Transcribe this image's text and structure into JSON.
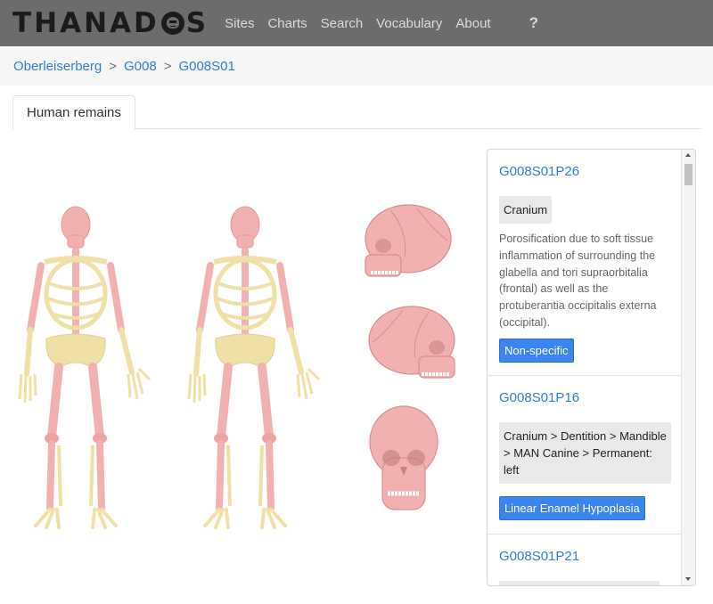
{
  "header": {
    "logo_text_pre": "THANAD",
    "logo_text_post": "S",
    "nav": [
      "Sites",
      "Charts",
      "Search",
      "Vocabulary",
      "About"
    ],
    "help_label": "?"
  },
  "breadcrumb": [
    "Oberleiserberg",
    "G008",
    "G008S01"
  ],
  "breadcrumb_sep": ">",
  "tabs": [
    {
      "label": "Human remains"
    }
  ],
  "panel": {
    "entries": [
      {
        "title": "G008S01P26",
        "tag": "Cranium",
        "description": "Porosification due to soft tissue inflammation of surrounding the glabella and tori supraorbitalia (frontal) as well as the protuberantia occipitalis externa (occipital).",
        "pill": "Non-specific"
      },
      {
        "title": "G008S01P16",
        "tag": "Cranium > Dentition > Mandible > MAN Canine > Permanent: left",
        "pill": "Linear Enamel Hypoplasia"
      },
      {
        "title": "G008S01P21"
      }
    ]
  },
  "colors": {
    "navbar": "#6c6c6c",
    "link": "#2f7fd6",
    "pill": "#3a84f0",
    "bone_healthy": "#efe1a6",
    "bone_affected": "#f2b1b1"
  }
}
